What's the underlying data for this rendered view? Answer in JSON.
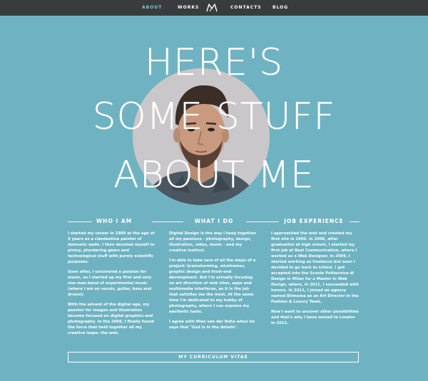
{
  "nav": {
    "about": "ABOUT",
    "works": "WORKS",
    "contacts": "CONTACTS",
    "blog": "BLOG",
    "logo_icon": "m-monogram-logo"
  },
  "headline": {
    "line1": "HERE'S",
    "line2": "SOME STUFF",
    "line3": "ABOUT ME"
  },
  "portrait_icon": "portrait-photo",
  "sections": {
    "who": {
      "title": "WHO I AM",
      "p1": "I started my career in 1989 at the age of 3 years as a clandestine painter of domestic walls. I then devoted myself to piracy, plundering gears and technological stuff with purely scientific purposes.",
      "p2": "Soon after, I uncovered a passion for music, so I started up my first and only one-man-band of experimental music (where I am on vocals, guitar, bass and drums).",
      "p3": "With the advent of the digital age, my passion for images and illustration become focused on digital graphics and photography. In the 2000, I finally found the force that held together all my creative leaps: the web."
    },
    "what": {
      "title": "WHAT I DO",
      "p1": "Digital Design is the way I keep together all my passions - photography, design, illustration, video, music - and my creative instinct.",
      "p2": "I'm able to take care of all the steps of a project: brainstorming, wireframes, graphic design and front-end development. But I'm actually focusing on art direction of web sites, apps and multimedia interfaces, as it is the job that satisfies me the most. At the same time I'm dedicated to my hobby of photography, where I can express my aesthetic taste.",
      "p3": "I agree with Mies van der Rohe when he says that \"God is in the details\"."
    },
    "job": {
      "title": "JOB EXPERIENCE",
      "p1": "I approached the web and created my first site in 2000. In 2006, after graduation at high school, I started my first job at Beal Communication, where I worked as a Web Designer. In 2009, I started working as freelance but soon I decided to go back to school. I got accepted into the Scuola Politecnica di Design in Milan for a Master in Web Design, where, in 2011, I succeeded with honors. In 2011, I joined an agency named Bitmama as an Art Director in the Fashion & Luxury Team.",
      "p2": "Now I want to uncover other possibilities and that's why I have moved to London in 2012."
    }
  },
  "cv_button": "MY CURRICULUM VITAE"
}
